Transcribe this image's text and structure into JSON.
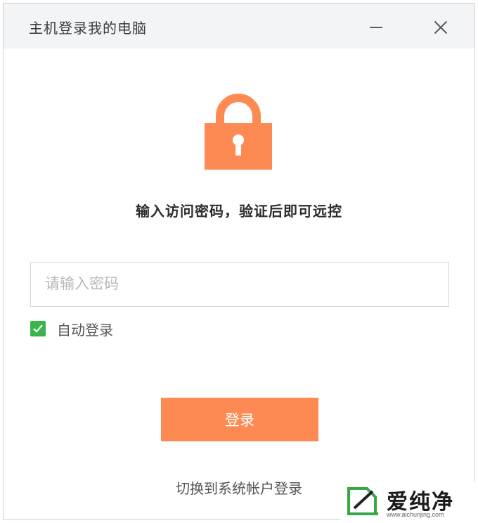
{
  "window": {
    "title": "主机登录我的电脑"
  },
  "lock_icon": "lock-icon",
  "prompt": "输入访问密码，验证后即可远控",
  "password": {
    "placeholder": "请输入密码",
    "value": ""
  },
  "auto_login": {
    "label": "自动登录",
    "checked": true
  },
  "login_button": "登录",
  "switch_link": "切换到系统帐户登录",
  "watermark": {
    "text": "爱纯净",
    "url": "www.aichunjing.com"
  },
  "colors": {
    "accent": "#fd8a52",
    "checkbox": "#3ab54a",
    "titlebar": "#f3f4f6"
  }
}
